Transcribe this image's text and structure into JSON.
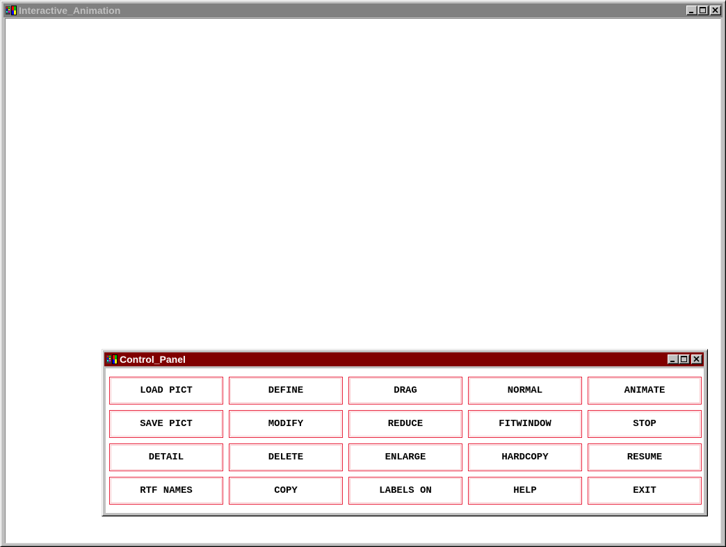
{
  "main_window": {
    "title": "Interactive_Animation",
    "title_color": "#c0c0c0",
    "titlebar_color": "#808080"
  },
  "control_panel": {
    "title": "Control_Panel",
    "titlebar_color": "#800000",
    "button_border_color": "#e8203a",
    "buttons": [
      [
        "LOAD PICT",
        "DEFINE",
        "DRAG",
        "NORMAL",
        "ANIMATE"
      ],
      [
        "SAVE PICT",
        "MODIFY",
        "REDUCE",
        "FITWINDOW",
        "STOP"
      ],
      [
        "DETAIL",
        "DELETE",
        "ENLARGE",
        "HARDCOPY",
        "RESUME"
      ],
      [
        "RTF NAMES",
        "COPY",
        "LABELS ON",
        "HELP",
        "EXIT"
      ]
    ]
  },
  "icons": {
    "app": "application-icon",
    "minimize": "minimize-icon",
    "maximize": "maximize-icon",
    "close": "close-icon"
  }
}
